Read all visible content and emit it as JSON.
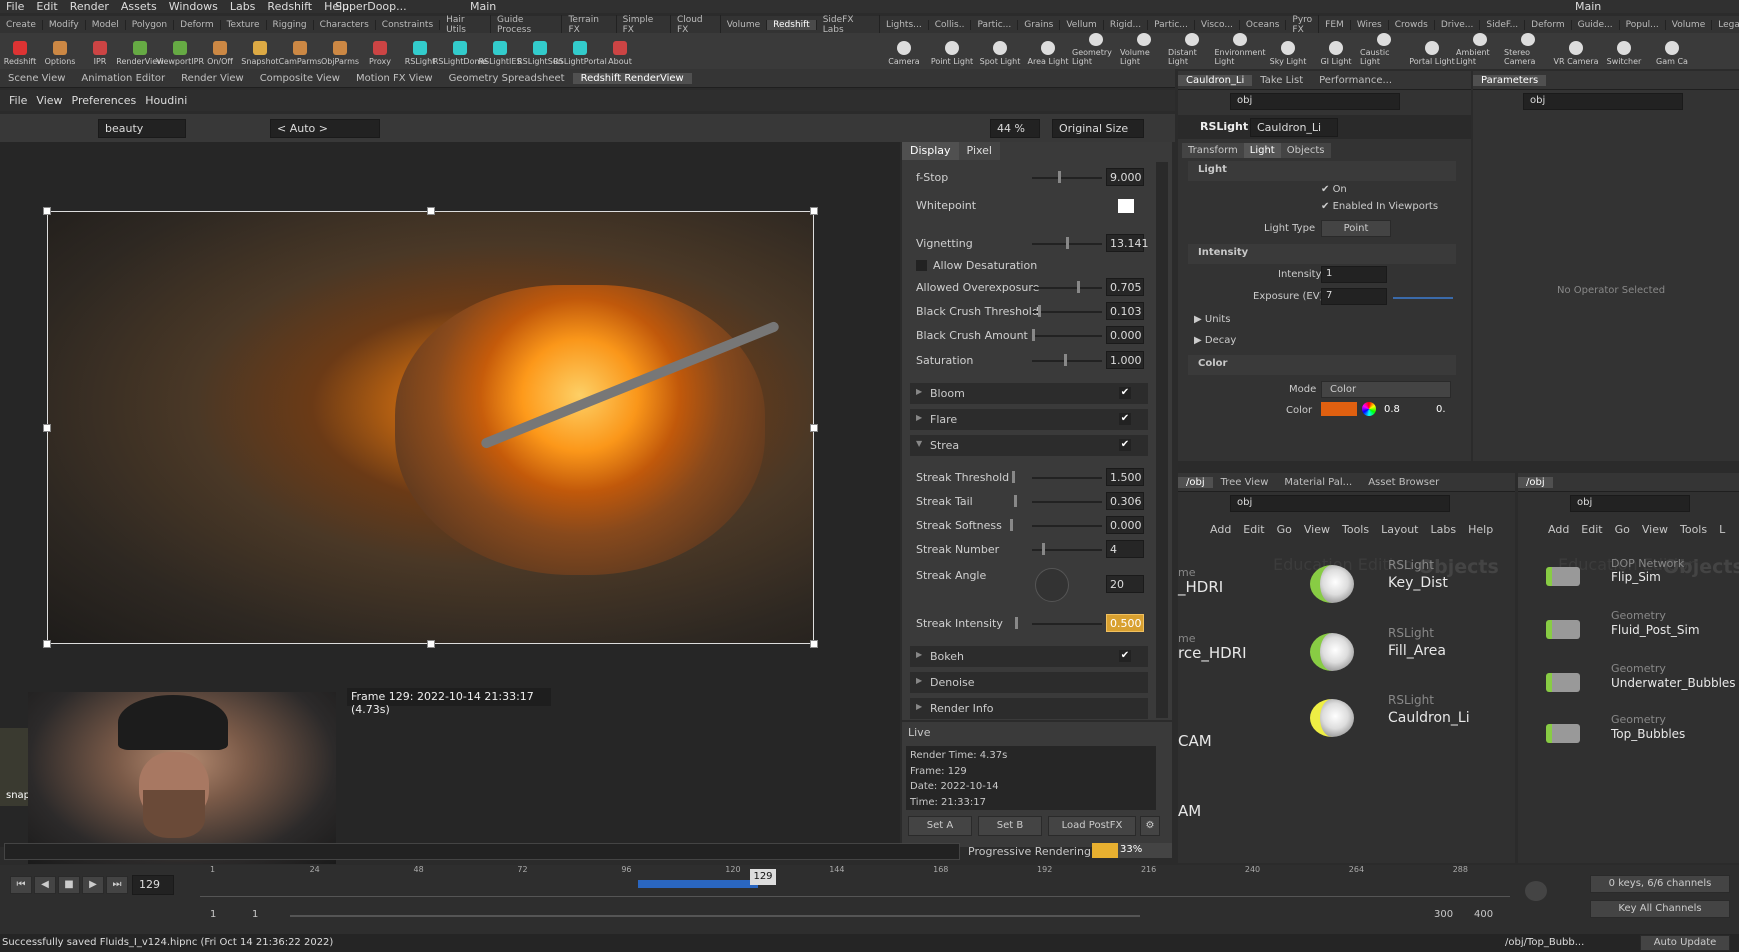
{
  "menubar": {
    "items": [
      "File",
      "Edit",
      "Render",
      "Assets",
      "Windows",
      "Labs",
      "Redshift",
      "Help"
    ],
    "desktop": "SuperDoop...",
    "main": "Main",
    "main_right": "Main"
  },
  "shelf": {
    "tabs": [
      "Create",
      "Modify",
      "Model",
      "Polygon",
      "Deform",
      "Texture",
      "Rigging",
      "Characters",
      "Constraints",
      "Hair Utils",
      "Guide Process",
      "Terrain FX",
      "Simple FX",
      "Cloud FX",
      "Volume",
      "Redshift",
      "SideFX Labs"
    ],
    "active": "Redshift",
    "tools": [
      "Redshift",
      "Options",
      "IPR",
      "RenderView",
      "ViewportIPR",
      "On/Off",
      "Snapshot",
      "CamParms",
      "ObjParms",
      "Proxy",
      "RSLight",
      "RSLightDome",
      "RSLightIES",
      "RSLightSun",
      "RSLightPortal",
      "About"
    ],
    "tool_colors": [
      "#d33",
      "#c84",
      "#c44",
      "#6a4",
      "#6a4",
      "#c84",
      "#da4",
      "#c84",
      "#c84",
      "#c44",
      "#3cc",
      "#3cc",
      "#3cc",
      "#3cc",
      "#3cc",
      "#c44"
    ]
  },
  "shelf2": {
    "tabs": [
      "Lights...",
      "Collis..",
      "Partic...",
      "Grains",
      "Vellum",
      "Rigid...",
      "Partic...",
      "Visco...",
      "Oceans",
      "Pyro FX",
      "FEM",
      "Wires",
      "Crowds",
      "Drive...",
      "SideF...",
      "Deform",
      "Guide...",
      "Popul...",
      "Volume",
      "Legac..."
    ],
    "tools": [
      "Camera",
      "Point Light",
      "Spot Light",
      "Area Light",
      "Geometry Light",
      "Volume Light",
      "Distant Light",
      "Environment Light",
      "Sky Light",
      "GI Light",
      "Caustic Light",
      "Portal Light",
      "Ambient Light",
      "Stereo Camera",
      "VR Camera",
      "Switcher",
      "Gam Ca"
    ]
  },
  "pane_tabs": [
    "Scene View",
    "Animation Editor",
    "Render View",
    "Composite View",
    "Motion FX View",
    "Geometry Spreadsheet",
    "Redshift RenderView"
  ],
  "pane_tabs_active": "Redshift RenderView",
  "rv_menu": [
    "File",
    "View",
    "Preferences",
    "Houdini"
  ],
  "rv_toolbar": {
    "aov": "beauty",
    "camera": "< Auto >",
    "zoom": "44 %",
    "size": "Original Size"
  },
  "caption": "Frame 129: 2022-10-14 21:33:17 (4.73s)",
  "webcam_label": "snap",
  "display_tabs": [
    "Display",
    "Pixel"
  ],
  "post": {
    "fstop": {
      "label": "f-Stop",
      "value": "9.000"
    },
    "whitepoint": {
      "label": "Whitepoint"
    },
    "vignetting": {
      "label": "Vignetting",
      "value": "13.141"
    },
    "allow_desat": {
      "label": "Allow Desaturation"
    },
    "allowed_over": {
      "label": "Allowed Overexposure",
      "value": "0.705"
    },
    "black_thresh": {
      "label": "Black Crush Threshold",
      "value": "0.103"
    },
    "black_amount": {
      "label": "Black Crush Amount",
      "value": "0.000"
    },
    "saturation": {
      "label": "Saturation",
      "value": "1.000"
    },
    "bloom": "Bloom",
    "flare": "Flare",
    "streak": "Strea",
    "streak_threshold": {
      "label": "Streak Threshold",
      "value": "1.500"
    },
    "streak_tail": {
      "label": "Streak Tail",
      "value": "0.306"
    },
    "streak_softness": {
      "label": "Streak Softness",
      "value": "0.000"
    },
    "streak_number": {
      "label": "Streak Number",
      "value": "4"
    },
    "streak_angle": {
      "label": "Streak Angle",
      "value": "20"
    },
    "streak_intensity": {
      "label": "Streak Intensity",
      "value": "0.500"
    },
    "bokeh": "Bokeh",
    "denoise": "Denoise",
    "render_info": "Render Info"
  },
  "live": {
    "title": "Live",
    "lines": [
      "Render Time: 4.37s",
      "Frame: 129",
      "Date: 2022-10-14",
      "Time: 21:33:17"
    ],
    "set_a": "Set A",
    "set_b": "Set B",
    "load_postfx": "Load PostFX"
  },
  "progress": {
    "label": "Progressive Rendering...",
    "pct": "33%"
  },
  "light_tabs": [
    "Cauldron_Li",
    "Take List",
    "Performance..."
  ],
  "rslight": {
    "type": "RSLight",
    "name": "Cauldron_Li",
    "tabs": [
      "Transform",
      "Light",
      "Objects"
    ],
    "active": "Light",
    "light_head": "Light",
    "on": "On",
    "enabled": "Enabled In Viewports",
    "light_type_lbl": "Light Type",
    "light_type": "Point",
    "intensity_head": "Intensity",
    "intensity_lbl": "Intensity",
    "intensity": "1",
    "exposure_lbl": "Exposure (EV)",
    "exposure": "7",
    "units": "Units",
    "decay": "Decay",
    "color_head": "Color",
    "mode_lbl": "Mode",
    "mode": "Color",
    "color_lbl": "Color",
    "color_val": "0.8",
    "color_val2": "0.",
    "color_swatch": "#e06010"
  },
  "path": "obj",
  "params": {
    "tab": "Parameters",
    "path": "obj",
    "empty": "No Operator Selected"
  },
  "net_tabs": [
    "/obj",
    "Tree View",
    "Material Pal...",
    "Asset Browser"
  ],
  "net_menu": [
    "Add",
    "Edit",
    "Go",
    "View",
    "Tools",
    "Layout",
    "Labs",
    "Help"
  ],
  "net_watermark": "Education Edition",
  "net_watermark2": "Objects",
  "net_left_labels": [
    "_HDRI",
    "rce_HDRI",
    "CAM",
    "AM"
  ],
  "net_left_labels_pre": [
    "me",
    "me"
  ],
  "nodes": [
    {
      "type": "RSLight",
      "name": "Key_Dist"
    },
    {
      "type": "RSLight",
      "name": "Fill_Area"
    },
    {
      "type": "RSLight",
      "name": "Cauldron_Li"
    }
  ],
  "net2_tab": "/obj",
  "net2_menu": [
    "Add",
    "Edit",
    "Go",
    "View",
    "Tools",
    "L"
  ],
  "net2_nodes": [
    {
      "type": "DOP Network",
      "name": "Flip_Sim"
    },
    {
      "type": "Geometry",
      "name": "Fluid_Post_Sim"
    },
    {
      "type": "Geometry",
      "name": "Underwater_Bubbles"
    },
    {
      "type": "Geometry",
      "name": "Top_Bubbles"
    }
  ],
  "timeline": {
    "frame": "129",
    "ticks": [
      "1",
      "24",
      "48",
      "72",
      "96",
      "120",
      "144",
      "168",
      "192",
      "216",
      "240",
      "264",
      "288"
    ],
    "start": "1",
    "start2": "1",
    "end": "300",
    "end2": "400",
    "keys": "0 keys, 6/6 channels",
    "key_all": "Key All Channels",
    "auto": "Auto Update"
  },
  "status": "Successfully saved Fluids_I_v124.hipnc (Fri Oct 14 21:36:22 2022)",
  "status_path": "/obj/Top_Bubb..."
}
